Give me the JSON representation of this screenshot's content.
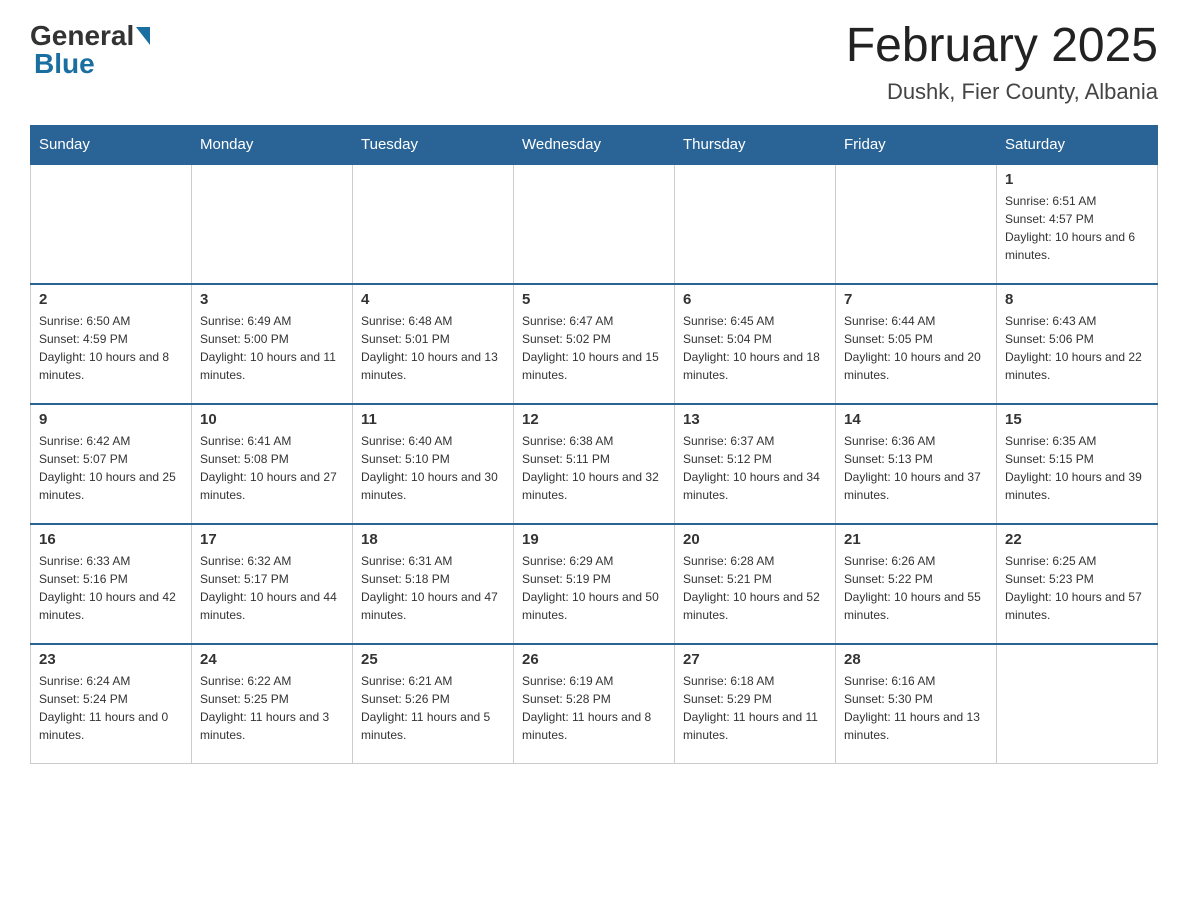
{
  "logo": {
    "general": "General",
    "blue": "Blue"
  },
  "header": {
    "month_year": "February 2025",
    "location": "Dushk, Fier County, Albania"
  },
  "weekdays": [
    "Sunday",
    "Monday",
    "Tuesday",
    "Wednesday",
    "Thursday",
    "Friday",
    "Saturday"
  ],
  "weeks": [
    [
      {
        "day": "",
        "info": ""
      },
      {
        "day": "",
        "info": ""
      },
      {
        "day": "",
        "info": ""
      },
      {
        "day": "",
        "info": ""
      },
      {
        "day": "",
        "info": ""
      },
      {
        "day": "",
        "info": ""
      },
      {
        "day": "1",
        "info": "Sunrise: 6:51 AM\nSunset: 4:57 PM\nDaylight: 10 hours and 6 minutes."
      }
    ],
    [
      {
        "day": "2",
        "info": "Sunrise: 6:50 AM\nSunset: 4:59 PM\nDaylight: 10 hours and 8 minutes."
      },
      {
        "day": "3",
        "info": "Sunrise: 6:49 AM\nSunset: 5:00 PM\nDaylight: 10 hours and 11 minutes."
      },
      {
        "day": "4",
        "info": "Sunrise: 6:48 AM\nSunset: 5:01 PM\nDaylight: 10 hours and 13 minutes."
      },
      {
        "day": "5",
        "info": "Sunrise: 6:47 AM\nSunset: 5:02 PM\nDaylight: 10 hours and 15 minutes."
      },
      {
        "day": "6",
        "info": "Sunrise: 6:45 AM\nSunset: 5:04 PM\nDaylight: 10 hours and 18 minutes."
      },
      {
        "day": "7",
        "info": "Sunrise: 6:44 AM\nSunset: 5:05 PM\nDaylight: 10 hours and 20 minutes."
      },
      {
        "day": "8",
        "info": "Sunrise: 6:43 AM\nSunset: 5:06 PM\nDaylight: 10 hours and 22 minutes."
      }
    ],
    [
      {
        "day": "9",
        "info": "Sunrise: 6:42 AM\nSunset: 5:07 PM\nDaylight: 10 hours and 25 minutes."
      },
      {
        "day": "10",
        "info": "Sunrise: 6:41 AM\nSunset: 5:08 PM\nDaylight: 10 hours and 27 minutes."
      },
      {
        "day": "11",
        "info": "Sunrise: 6:40 AM\nSunset: 5:10 PM\nDaylight: 10 hours and 30 minutes."
      },
      {
        "day": "12",
        "info": "Sunrise: 6:38 AM\nSunset: 5:11 PM\nDaylight: 10 hours and 32 minutes."
      },
      {
        "day": "13",
        "info": "Sunrise: 6:37 AM\nSunset: 5:12 PM\nDaylight: 10 hours and 34 minutes."
      },
      {
        "day": "14",
        "info": "Sunrise: 6:36 AM\nSunset: 5:13 PM\nDaylight: 10 hours and 37 minutes."
      },
      {
        "day": "15",
        "info": "Sunrise: 6:35 AM\nSunset: 5:15 PM\nDaylight: 10 hours and 39 minutes."
      }
    ],
    [
      {
        "day": "16",
        "info": "Sunrise: 6:33 AM\nSunset: 5:16 PM\nDaylight: 10 hours and 42 minutes."
      },
      {
        "day": "17",
        "info": "Sunrise: 6:32 AM\nSunset: 5:17 PM\nDaylight: 10 hours and 44 minutes."
      },
      {
        "day": "18",
        "info": "Sunrise: 6:31 AM\nSunset: 5:18 PM\nDaylight: 10 hours and 47 minutes."
      },
      {
        "day": "19",
        "info": "Sunrise: 6:29 AM\nSunset: 5:19 PM\nDaylight: 10 hours and 50 minutes."
      },
      {
        "day": "20",
        "info": "Sunrise: 6:28 AM\nSunset: 5:21 PM\nDaylight: 10 hours and 52 minutes."
      },
      {
        "day": "21",
        "info": "Sunrise: 6:26 AM\nSunset: 5:22 PM\nDaylight: 10 hours and 55 minutes."
      },
      {
        "day": "22",
        "info": "Sunrise: 6:25 AM\nSunset: 5:23 PM\nDaylight: 10 hours and 57 minutes."
      }
    ],
    [
      {
        "day": "23",
        "info": "Sunrise: 6:24 AM\nSunset: 5:24 PM\nDaylight: 11 hours and 0 minutes."
      },
      {
        "day": "24",
        "info": "Sunrise: 6:22 AM\nSunset: 5:25 PM\nDaylight: 11 hours and 3 minutes."
      },
      {
        "day": "25",
        "info": "Sunrise: 6:21 AM\nSunset: 5:26 PM\nDaylight: 11 hours and 5 minutes."
      },
      {
        "day": "26",
        "info": "Sunrise: 6:19 AM\nSunset: 5:28 PM\nDaylight: 11 hours and 8 minutes."
      },
      {
        "day": "27",
        "info": "Sunrise: 6:18 AM\nSunset: 5:29 PM\nDaylight: 11 hours and 11 minutes."
      },
      {
        "day": "28",
        "info": "Sunrise: 6:16 AM\nSunset: 5:30 PM\nDaylight: 11 hours and 13 minutes."
      },
      {
        "day": "",
        "info": ""
      }
    ]
  ]
}
